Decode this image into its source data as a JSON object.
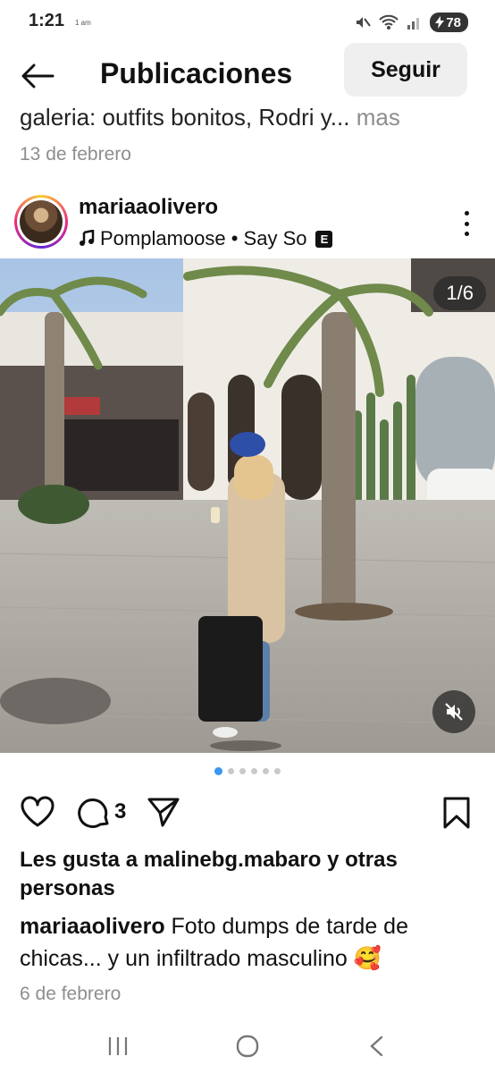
{
  "status": {
    "time": "1:21",
    "time_suffix": "1 am",
    "battery": "78"
  },
  "header": {
    "title": "Publicaciones",
    "follow_label": "Seguir"
  },
  "previous_post": {
    "caption": "galeria: outfits bonitos, Rodri y...",
    "more": " mas",
    "date": "13 de febrero"
  },
  "post": {
    "username": "mariaaolivero",
    "music": "Pomplamoose • Say So",
    "explicit": "E",
    "counter": "1/6",
    "comment_count": "3",
    "likes_prefix": "Les gusta a malinebg.mabaro y ",
    "likes_suffix": "otras personas",
    "caption_user": "mariaaolivero",
    "caption_text": " Foto dumps de tarde de chicas... y un infiltrado masculino 🥰",
    "date": "6 de febrero"
  },
  "carousel": {
    "total": 6,
    "active": 0
  },
  "colors": {
    "accent": "#3897f0",
    "muted": "#8e8e8e"
  }
}
